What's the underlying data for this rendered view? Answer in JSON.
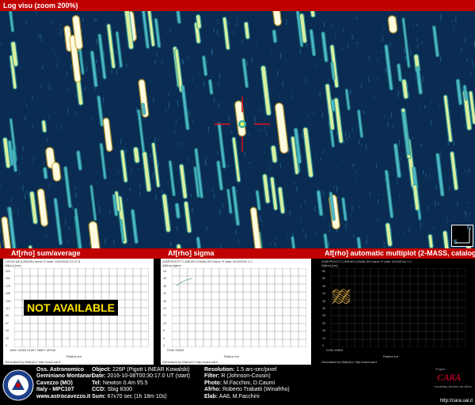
{
  "window": {
    "title": "Log visu (zoom 200%)"
  },
  "plots": {
    "left": {
      "title": "Af[rho] sum/average",
      "meta": "C/2016 A6 (LINEAR)         band: R  date:  11/6/2016 21:27:6",
      "ylabel": "Af[rho] [cm]",
      "yticks": [
        "224",
        "201",
        "179",
        "156",
        "134",
        "112",
        "89",
        "67",
        "44",
        "22",
        "0"
      ],
      "xticks": "1840   14060   21597   28507   40758",
      "xticks2": "9830   21365   34011   47295",
      "xlabel": "Radius km",
      "footer": "Generated by Wafr(m)?   http://cara.uai.it",
      "overlay": "NOT AVAILABLE"
    },
    "middle": {
      "title": "Af[rho] sigma",
      "meta": "226P/PIGOTT-LINEAR-KOWALSKI    band: R   date:  8/10/2016  1:2",
      "ylabel": "Af[rho] sigma",
      "yticks": [
        "44",
        "40",
        "35",
        "31",
        "26",
        "22",
        "17",
        "13",
        "8",
        "4",
        "0"
      ],
      "xticks": "2156   19825",
      "xticks2": "9911    24144",
      "xlabel": "Radius km",
      "footer": "Generated by Wafr(m)?   http://cara.uai.it"
    },
    "right": {
      "title": "Af[rho] automatic multiplot (2-MASS, catalog)",
      "meta": "226P/PIGOTT-LINEAR-KOWALSKI    band: R   date:  8/10/2016  1:2",
      "ylabel": "Af[rho] [cm]",
      "yticks": [
        "55",
        "50",
        "45",
        "40",
        "35",
        "30",
        "25",
        "20",
        "15",
        "10",
        "0"
      ],
      "xticks": "2156   19825",
      "xticks2": "9911    24144",
      "xlabel": "Radius km",
      "footer": "Generated by Wafr(m)?   http://cara.uai.it"
    }
  },
  "compass": {
    "north": "N",
    "east": "E"
  },
  "footer": {
    "observatory": {
      "line1": "Oss. Astronomico",
      "line2": "Geminiano Montanari",
      "line3": "Cavezzo (MO)",
      "line4": "Italy - MPC107",
      "line5": "www.astrocavezzo.it"
    },
    "details": [
      {
        "label": "Object:",
        "value": "226P (Pigott LINEAR Kowalski)"
      },
      {
        "label": "Date:",
        "value": "2016-10-08T00:30:17.0 UT (start)"
      },
      {
        "label": "Tel:",
        "value": "Newton 0.4m f/5.5"
      },
      {
        "label": "CCD:",
        "value": "Sbig 8300"
      },
      {
        "label": "Sum:",
        "value": "67x70 sec (1h 18m 10s)"
      }
    ],
    "params": [
      {
        "label": "Resolution:",
        "value": "1.5 arc-sec/pixel"
      },
      {
        "label": "Filter:",
        "value": "R (Johnson-Cousin)"
      },
      {
        "label": "Photo:",
        "value": "M.Facchini, D.Caumi"
      },
      {
        "label": "Afrho:",
        "value": "Roberto Trabatti (Winafrho)"
      },
      {
        "label": "Elab:",
        "value": "AA6, M.Facchini"
      }
    ],
    "cara": {
      "prefix": "Project",
      "name": "CARA",
      "tagline": "Cometary Archive for Afrho",
      "url": "http://cara.uai.it"
    }
  },
  "colors": {
    "header_red": "#c00000",
    "sky_blue": "#0a2c52",
    "overlay_yellow": "#ffe600"
  }
}
